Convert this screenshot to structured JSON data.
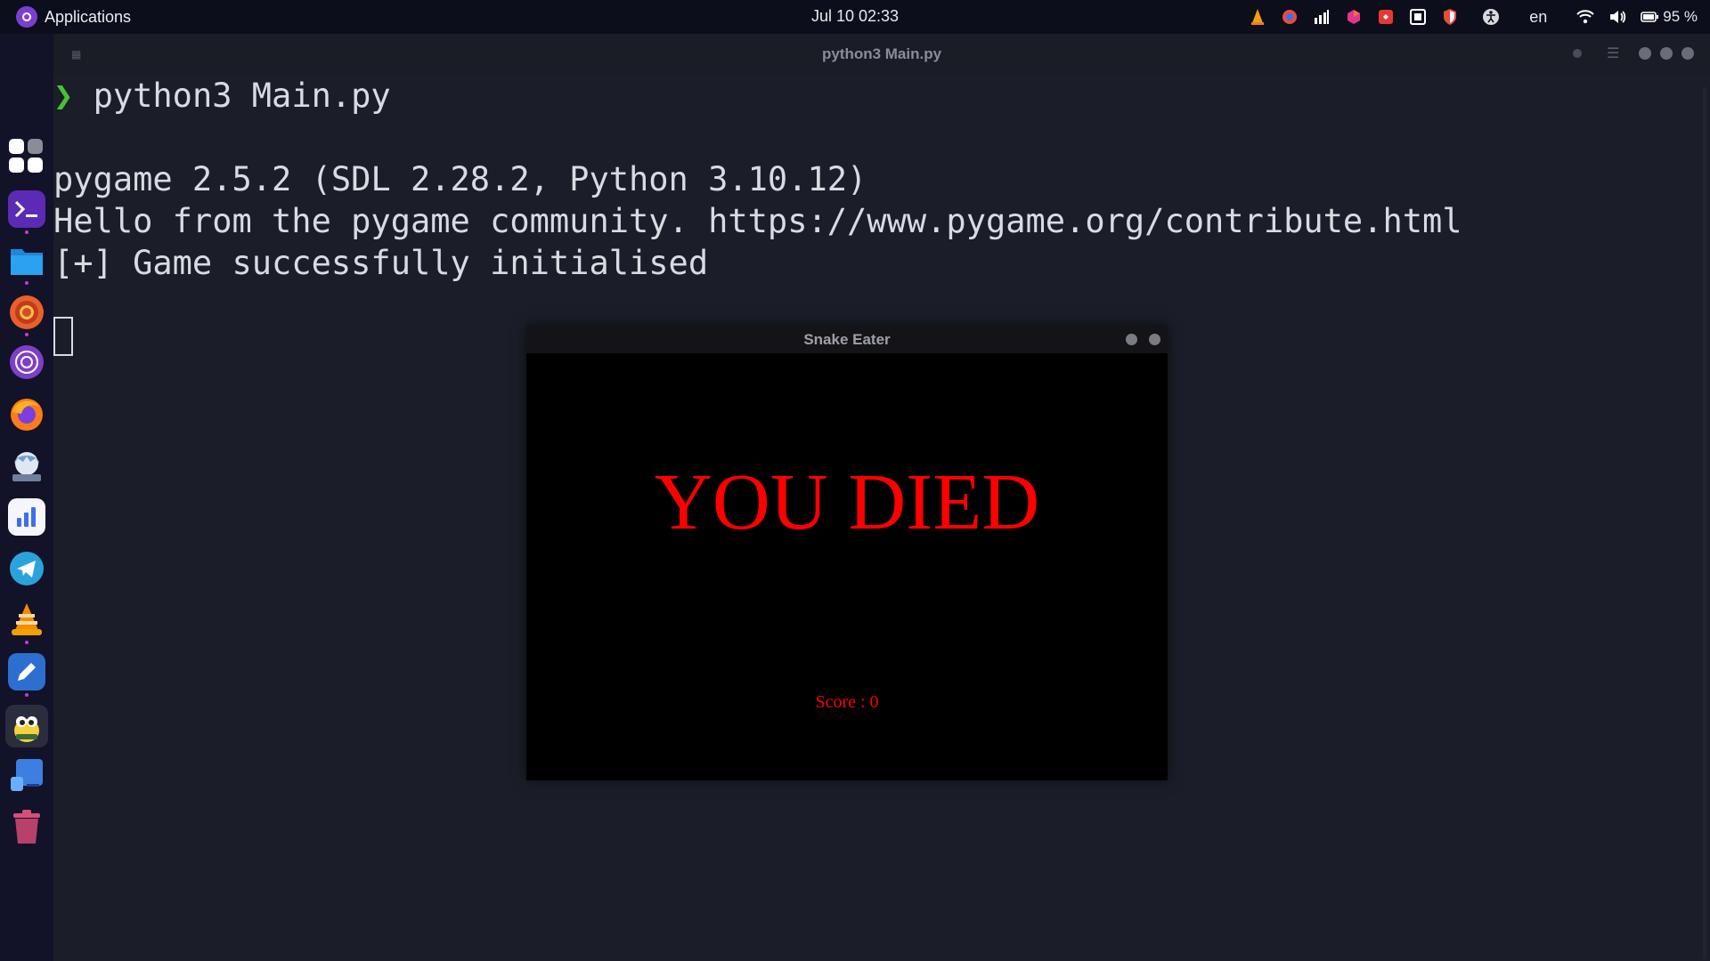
{
  "topbar": {
    "apps_label": "Applications",
    "datetime": "Jul 10  02:33",
    "lang": "en",
    "battery": "95 %",
    "tray_icons": [
      "vlc-icon",
      "chromium-icon",
      "stats-icon",
      "gitkraken-icon",
      "anydesk-icon",
      "remote-icon",
      "shield-icon",
      "accessibility-icon",
      "wifi-icon",
      "volume-icon",
      "battery-icon"
    ]
  },
  "dock": {
    "items": [
      "app-grid",
      "terminal",
      "files",
      "chrome",
      "tor-browser",
      "firefox",
      "anime-app",
      "analytics",
      "telegram",
      "vlc",
      "code-editor",
      "pygame",
      "desktop-app",
      "trash"
    ]
  },
  "terminal": {
    "title": "python3 Main.py",
    "prompt_symbol": "❯",
    "command": "python3 Main.py",
    "lines": [
      "pygame 2.5.2 (SDL 2.28.2, Python 3.10.12)",
      "Hello from the pygame community. https://www.pygame.org/contribute.html",
      "[+] Game successfully initialised"
    ]
  },
  "game": {
    "window_title": "Snake Eater",
    "message": "YOU DIED",
    "score_text": "Score : 0",
    "text_color": "#ff0000",
    "background": "#000000"
  }
}
